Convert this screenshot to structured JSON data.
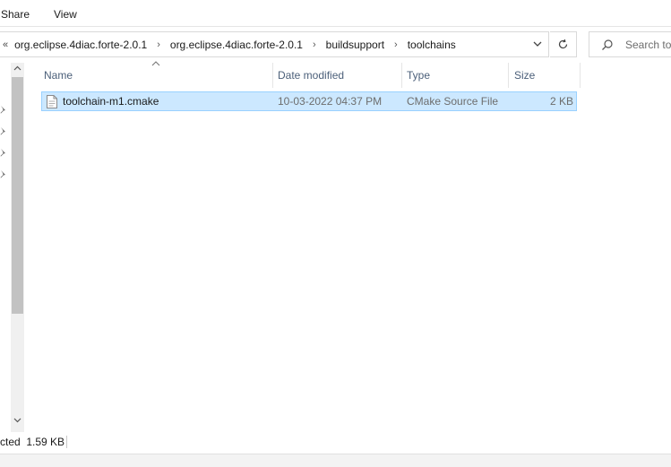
{
  "ribbon": {
    "tabs": [
      "Share",
      "View"
    ]
  },
  "address_bar": {
    "overflow_symbol": "«",
    "crumbs": [
      "org.eclipse.4diac.forte-2.0.1",
      "org.eclipse.4diac.forte-2.0.1",
      "buildsupport",
      "toolchains"
    ],
    "separator_icon": "chevron-right-icon",
    "dropdown_icon": "chevron-down-icon",
    "refresh_icon": "refresh-icon"
  },
  "search": {
    "placeholder": "Search toolchains",
    "visible_text": "Search too",
    "icon": "search-icon"
  },
  "file_list": {
    "columns": [
      "Name",
      "Date modified",
      "Type",
      "Size"
    ],
    "sorted_column": "Name",
    "rows": [
      {
        "name": "toolchain-m1.cmake",
        "date_modified": "10-03-2022 04:37 PM",
        "type": "CMake Source File",
        "size": "2 KB",
        "selected": true
      }
    ]
  },
  "status_bar": {
    "selection_text": "cted",
    "selection_size": "1.59 KB"
  },
  "colors": {
    "selection_bg": "#cce8ff",
    "selection_border": "#99d1ff",
    "header_text": "#4c607a",
    "secondary_text": "#6d6d6d",
    "scroll_thumb": "#c2c2c2"
  }
}
